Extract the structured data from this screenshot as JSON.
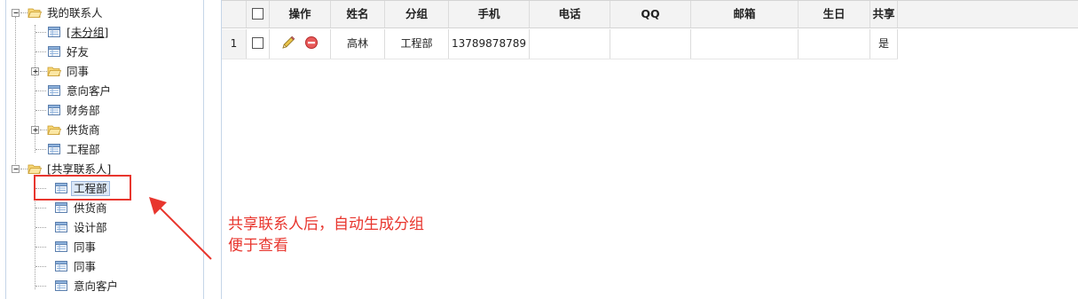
{
  "tree": {
    "nodes": [
      {
        "label": "我的联系人",
        "type": "folder",
        "toggle": "minus"
      },
      {
        "label": "[未分组]",
        "type": "list"
      },
      {
        "label": "好友",
        "type": "list"
      },
      {
        "label": "同事",
        "type": "folder",
        "toggle": "plus"
      },
      {
        "label": "意向客户",
        "type": "list"
      },
      {
        "label": "财务部",
        "type": "list"
      },
      {
        "label": "供货商",
        "type": "folder",
        "toggle": "plus"
      },
      {
        "label": "工程部",
        "type": "list"
      },
      {
        "label": "[共享联系人]",
        "type": "folder",
        "toggle": "minus"
      },
      {
        "label": "工程部",
        "type": "list",
        "selected": true
      },
      {
        "label": "供货商",
        "type": "list"
      },
      {
        "label": "设计部",
        "type": "list"
      },
      {
        "label": "同事",
        "type": "list"
      },
      {
        "label": "同事",
        "type": "list"
      },
      {
        "label": "意向客户",
        "type": "list"
      }
    ]
  },
  "grid": {
    "columns": [
      "操作",
      "姓名",
      "分组",
      "手机",
      "电话",
      "QQ",
      "邮箱",
      "生日",
      "共享"
    ],
    "rows": [
      {
        "num": "1",
        "name": "高林",
        "group": "工程部",
        "mobile": "13789878789",
        "phone": "",
        "qq": "",
        "email": "",
        "birthday": "",
        "shared": "是"
      }
    ]
  },
  "annotation": {
    "line1": "共享联系人后，自动生成分组",
    "line2": "便于查看"
  },
  "colors": {
    "annotation": "#e8362e",
    "selected_bg": "#dbe7f7",
    "header_bg": "#f3f3f3"
  }
}
